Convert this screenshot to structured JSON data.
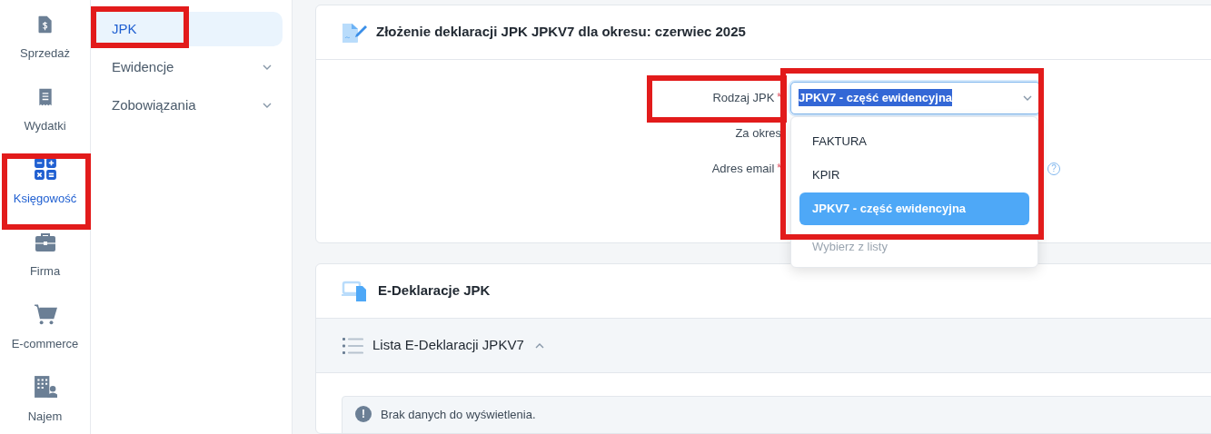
{
  "nav_rail": [
    {
      "label": "Sprzedaż",
      "selected": false,
      "highlighted": false
    },
    {
      "label": "Wydatki",
      "selected": false,
      "highlighted": false
    },
    {
      "label": "Księgowość",
      "selected": true,
      "highlighted": true
    },
    {
      "label": "Firma",
      "selected": false,
      "highlighted": false
    },
    {
      "label": "E-commerce",
      "selected": false,
      "highlighted": false
    },
    {
      "label": "Najem",
      "selected": false,
      "highlighted": false
    }
  ],
  "submenu": [
    {
      "label": "JPK",
      "selected": true,
      "expandable": false,
      "highlighted": true
    },
    {
      "label": "Ewidencje",
      "selected": false,
      "expandable": true,
      "highlighted": false
    },
    {
      "label": "Zobowiązania",
      "selected": false,
      "expandable": true,
      "highlighted": false
    }
  ],
  "declaration_card": {
    "title": "Złożenie deklaracji JPK JPKV7 dla okresu: czerwiec 2025",
    "fields": [
      {
        "label": "Rodzaj JPK",
        "required_mark": "*",
        "kind": "select",
        "value": "JPKV7 - część ewidencyjna",
        "expanded": true,
        "highlighted": true
      },
      {
        "label": "Za okres",
        "kind": "text",
        "highlighted": false
      },
      {
        "label": "Adres email",
        "required_mark": "*",
        "kind": "text",
        "highlighted": false,
        "help_icon": "?"
      }
    ],
    "dropdown": {
      "highlighted": true,
      "options": [
        {
          "label": "FAKTURA",
          "kind": "option",
          "selected": false
        },
        {
          "label": "KPIR",
          "kind": "option",
          "selected": false
        },
        {
          "label": "JPKV7 - część ewidencyjna",
          "kind": "option",
          "selected": true
        },
        {
          "label": "Wybierz z listy",
          "kind": "placeholder",
          "selected": false
        }
      ]
    }
  },
  "edeclarations_card": {
    "title": "E-Deklaracje JPK",
    "list_title": "Lista E-Deklaracji JPKV7",
    "list_expanded": true,
    "alert_icon": "!",
    "empty_message": "Brak danych do wyświetlenia."
  }
}
